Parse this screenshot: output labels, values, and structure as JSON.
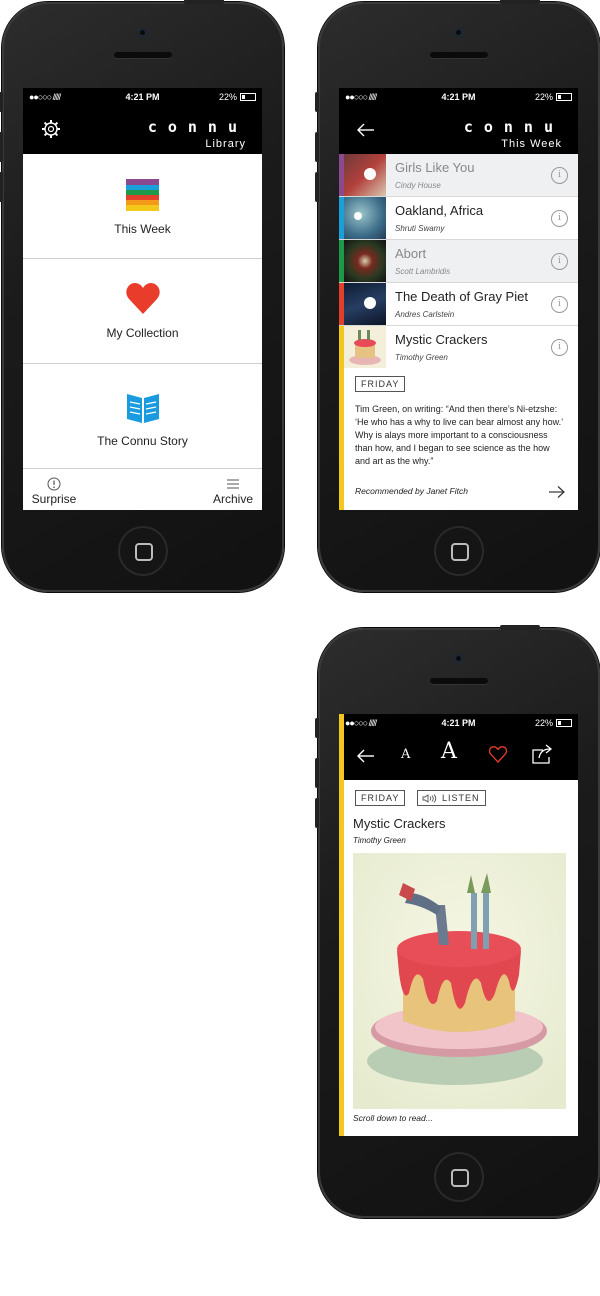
{
  "status": {
    "signal": "●●○○○ /////",
    "time": "4:21 PM",
    "battery": "22%"
  },
  "brand": {
    "logo": "connu"
  },
  "library": {
    "subtitle": "Library",
    "items": [
      {
        "label": "This Week"
      },
      {
        "label": "My Collection"
      },
      {
        "label": "The Connu Story"
      }
    ],
    "bottom": {
      "surprise": "Surprise",
      "archive": "Archive"
    }
  },
  "week": {
    "subtitle": "This Week",
    "stories": [
      {
        "title": "Girls Like You",
        "author": "Cindy House",
        "color": "#8b4a8f"
      },
      {
        "title": "Oakland, Africa",
        "author": "Shruti Swamy",
        "color": "#1aa0d8"
      },
      {
        "title": "Abort",
        "author": "Scott Lambridis",
        "color": "#1c9a4a"
      },
      {
        "title": "The Death of Gray Piet",
        "author": "Andres Carlstein",
        "color": "#e2402a"
      },
      {
        "title": "Mystic Crackers",
        "author": "Timothy Green",
        "color": "#f3c81b"
      }
    ],
    "day_tag": "FRIDAY",
    "excerpt": "Tim Green, on writing: “And then there’s Ni-etzshe: ‘He who has a why to live can bear almost any how.’ Why is alays more important to a consciousness than how, and I began to see science as the how and art as the why.”",
    "recommended": "Recommended by Janet Fitch"
  },
  "reader": {
    "day_tag": "FRIDAY",
    "listen": "LISTEN",
    "font_small": "A",
    "font_large": "A",
    "title": "Mystic Crackers",
    "author": "Timothy Green",
    "scroll_hint": "Scroll down to read..."
  }
}
